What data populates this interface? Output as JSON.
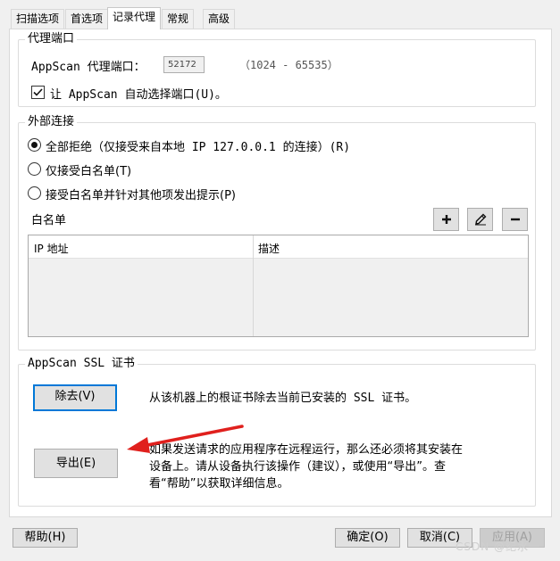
{
  "tabs": [
    "扫描选项",
    "首选项",
    "记录代理",
    "常规",
    "高级"
  ],
  "proxy_port": {
    "group_title": "代理端口",
    "label": "AppScan 代理端口：",
    "value": "52172",
    "range": "（1024 - 65535）",
    "auto_select_label": "让 AppScan 自动选择端口(U)。",
    "auto_select_checked": true
  },
  "external": {
    "group_title": "外部连接",
    "options": [
      "全部拒绝（仅接受来自本地 IP 127.0.0.1 的连接）(R)",
      "仅接受白名单(T)",
      "接受白名单并针对其他项发出提示(P)"
    ],
    "selected_index": 0,
    "whitelist_label": "白名单",
    "columns": [
      "IP 地址",
      "描述"
    ],
    "rows": []
  },
  "ssl": {
    "group_title": "AppScan SSL 证书",
    "remove_button": "除去(V)",
    "remove_desc": "从该机器上的根证书除去当前已安装的 SSL 证书。",
    "export_button": "导出(E)",
    "export_desc": [
      "如果发送请求的应用程序在远程运行，那么还必须将其安装在",
      "设备上。请从设备执行该操作（建议），或使用“导出”。查",
      "看“帮助”以获取详细信息。"
    ]
  },
  "footer": {
    "help": "帮助(H)",
    "ok": "确定(O)",
    "cancel": "取消(C)",
    "apply": "应用(A)"
  },
  "watermark": "CSDN @纪水一",
  "colors": {
    "arrow": "#e0201d",
    "focus": "#0078d7"
  }
}
